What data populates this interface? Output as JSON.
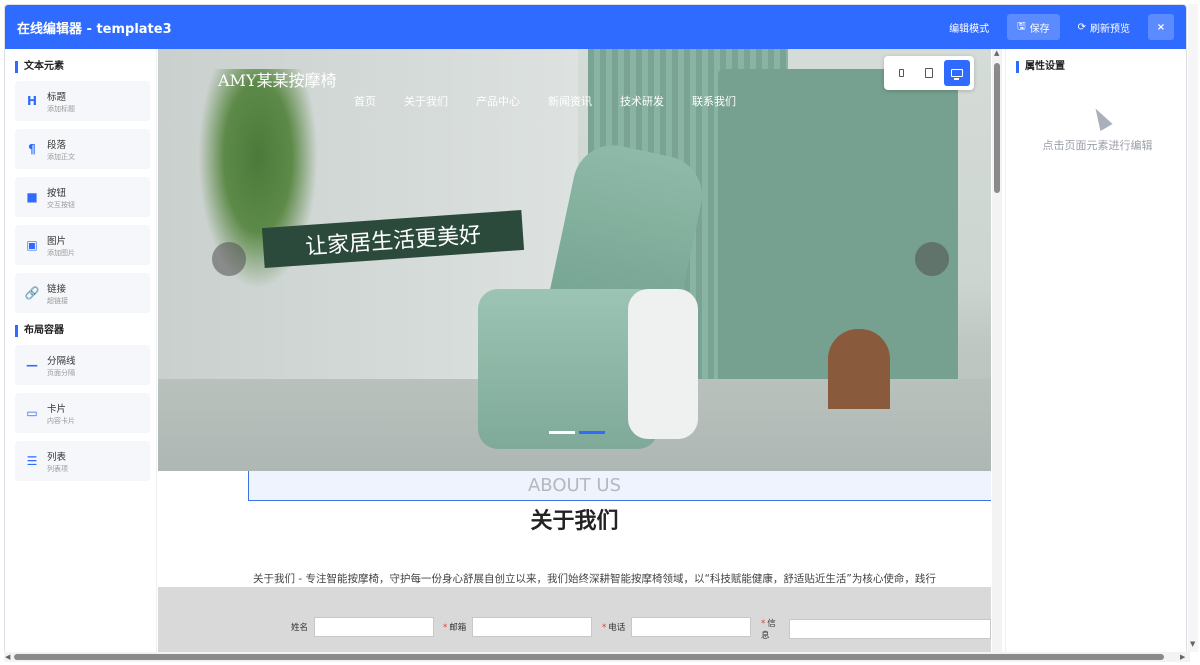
{
  "header": {
    "title": "在线编辑器 - template3",
    "edit_mode": "编辑模式",
    "save": "保存",
    "refresh_preview": "刷新预览",
    "close": "×"
  },
  "sidebar": {
    "text_section": "文本元素",
    "layout_section": "布局容器",
    "text_items": [
      {
        "icon": "H",
        "name": "标题",
        "desc": "添加标题"
      },
      {
        "icon": "¶",
        "name": "段落",
        "desc": "添加正文"
      },
      {
        "icon": "■",
        "name": "按钮",
        "desc": "交互按钮"
      },
      {
        "icon": "▣",
        "name": "图片",
        "desc": "添加图片"
      },
      {
        "icon": "🔗",
        "name": "链接",
        "desc": "超链接"
      }
    ],
    "layout_items": [
      {
        "icon": "—",
        "name": "分隔线",
        "desc": "页面分隔"
      },
      {
        "icon": "▭",
        "name": "卡片",
        "desc": "内容卡片"
      },
      {
        "icon": "☰",
        "name": "列表",
        "desc": "列表项"
      }
    ]
  },
  "canvas": {
    "brand": "AMY某某按摩椅",
    "slogan": "让家居生活更美好",
    "nav": [
      "首页",
      "关于我们",
      "产品中心",
      "新闻资讯",
      "技术研发",
      "联系我们"
    ],
    "about_en": "ABOUT US",
    "about_cn": "关于我们",
    "about_desc": "关于我们 - 专注智能按摩椅，守护每一份身心舒展自创立以来，我们始终深耕智能按摩椅领域，以“科技赋能健康，舒适贴近生活”为核心使命，践行",
    "form": {
      "name": "姓名",
      "email": "邮箱",
      "phone": "电话",
      "message": "信息",
      "required_mark": "*"
    }
  },
  "props": {
    "title": "属性设置",
    "hint": "点击页面元素进行编辑"
  },
  "colors": {
    "accent": "#2f6bff",
    "required": "#e53935"
  }
}
